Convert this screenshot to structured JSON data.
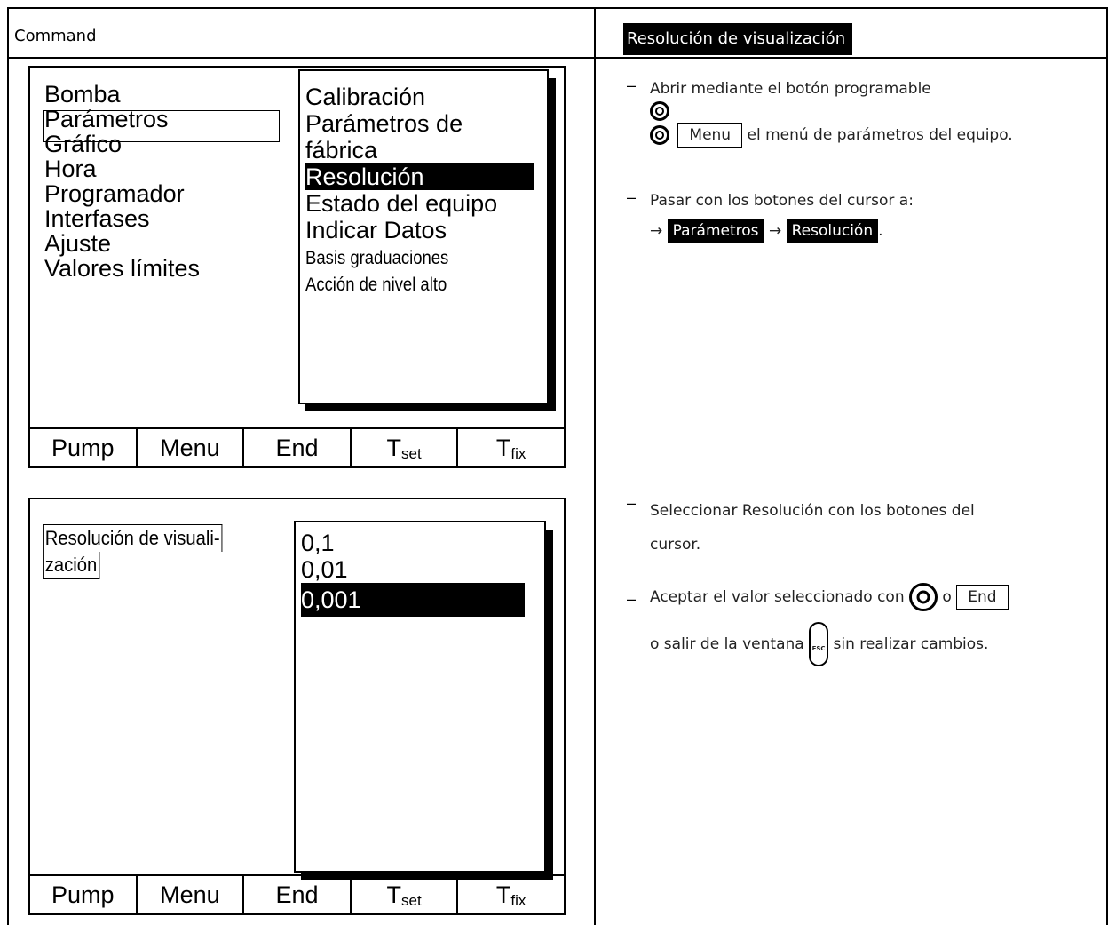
{
  "header": {
    "left_title": "Command",
    "right_title": "Resolución de visualización"
  },
  "screen1": {
    "menu_items": [
      "Bomba",
      "Parámetros",
      "Gráfico",
      "Hora",
      "Programador",
      "Interfases",
      "Ajuste",
      "Valores límites"
    ],
    "submenu_items": [
      "Calibración",
      "Parámetros de",
      "fábrica",
      "Resolución",
      "Estado del equipo",
      "Indicar Datos",
      "Basis graduaciones",
      "Acción de nivel alto"
    ],
    "softkeys": [
      "Pump",
      "Menu",
      "End",
      "T",
      "T"
    ],
    "softkey_subs": [
      "set",
      "fix"
    ]
  },
  "screen2": {
    "label_line1": "Resolución de visuali-",
    "label_line2": "zación",
    "options": [
      "0,1",
      "0,01",
      "0,001"
    ],
    "softkeys": [
      "Pump",
      "Menu",
      "End",
      "T",
      "T"
    ],
    "softkey_subs": [
      "set",
      "fix"
    ]
  },
  "instructions": {
    "dash": "–",
    "step1_line1": "Abrir mediante el botón programable",
    "step1_key": "Menu",
    "step1_line2": "el menú de parámetros del equipo.",
    "step2_line1": "Pasar con los botones del cursor a:",
    "arrow": "→",
    "step2_sel1": "Parámetros",
    "step2_sel2": "Resolución",
    "period": ".",
    "step3_line1": "Seleccionar Resolución con los botones del",
    "step3_line2": "cursor.",
    "step4_line1a": "Aceptar el valor seleccionado con",
    "step4_or": "o",
    "step4_key": "End",
    "step4_line2a": "o salir de la ventana",
    "step4_line2b": "sin realizar cambios.",
    "esc_label": "ESC"
  }
}
